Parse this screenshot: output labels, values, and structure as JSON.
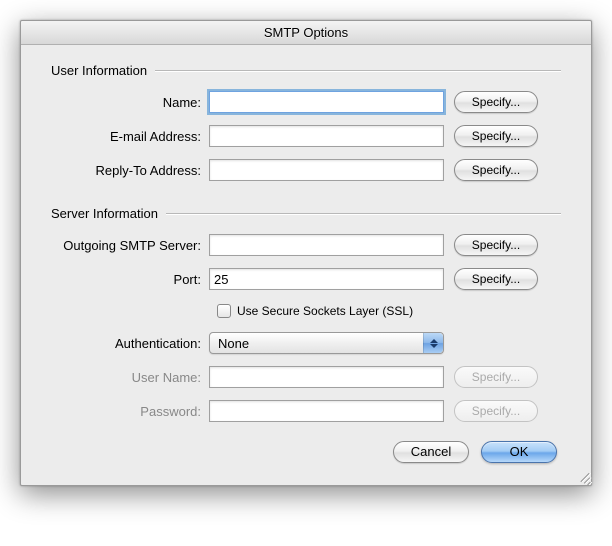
{
  "window": {
    "title": "SMTP Options"
  },
  "groups": {
    "user": {
      "title": "User Information"
    },
    "server": {
      "title": "Server Information"
    }
  },
  "labels": {
    "name": "Name:",
    "email": "E-mail Address:",
    "replyto": "Reply-To Address:",
    "smtp": "Outgoing SMTP Server:",
    "port": "Port:",
    "ssl": "Use Secure Sockets Layer (SSL)",
    "auth": "Authentication:",
    "username": "User Name:",
    "password": "Password:"
  },
  "values": {
    "name": "",
    "email": "",
    "replyto": "",
    "smtp": "",
    "port": "25",
    "ssl_checked": false,
    "auth": "None",
    "username": "",
    "password": ""
  },
  "buttons": {
    "specify": "Specify...",
    "cancel": "Cancel",
    "ok": "OK"
  }
}
